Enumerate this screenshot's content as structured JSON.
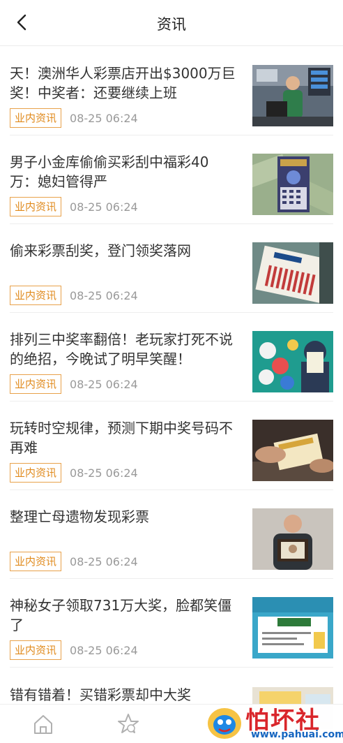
{
  "header": {
    "title": "资讯"
  },
  "news": [
    {
      "title": "天！澳洲华人彩票店开出$3000万巨奖！中奖者：还要继续上班",
      "tag": "业内资讯",
      "time": "08-25 06:24"
    },
    {
      "title": "男子小金库偷偷买彩刮中福彩40万：媳妇管得严",
      "tag": "业内资讯",
      "time": "08-25 06:24"
    },
    {
      "title": "偷来彩票刮奖，登门领奖落网",
      "tag": "业内资讯",
      "time": "08-25 06:24"
    },
    {
      "title": "排列三中奖率翻倍！老玩家打死不说的绝招，今晚试了明早笑醒！",
      "tag": "业内资讯",
      "time": "08-25 06:24"
    },
    {
      "title": "玩转时空规律，预测下期中奖号码不再难",
      "tag": "业内资讯",
      "time": "08-25 06:24"
    },
    {
      "title": "整理亡母遗物发现彩票",
      "tag": "业内资讯",
      "time": "08-25 06:24"
    },
    {
      "title": "神秘女子领取731万大奖，脸都笑僵了",
      "tag": "业内资讯",
      "time": "08-25 06:24"
    }
  ],
  "partial_news": {
    "title": "错有错着！买错彩票却中大奖"
  },
  "watermark": {
    "text": "怕坏社区",
    "url": "www.pahuai.com"
  },
  "icons": {
    "back": "chevron-left-icon",
    "tab_home": "home-icon",
    "tab_star": "star-icon"
  },
  "colors": {
    "tag": "#e08a1c",
    "watermark": "#d9262b",
    "url": "#1565c0"
  }
}
